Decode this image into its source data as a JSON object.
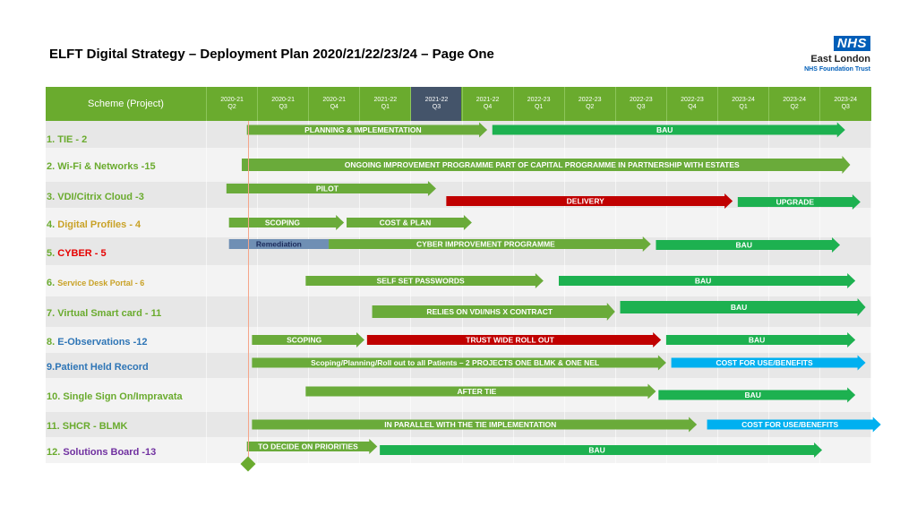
{
  "title": "ELFT Digital Strategy – Deployment Plan 2020/21/22/23/24 – Page One",
  "logo": {
    "mark": "NHS",
    "org": "East London",
    "trust": "NHS Foundation Trust"
  },
  "header": {
    "scheme_label": "Scheme (Project)",
    "quarters": [
      {
        "year": "2020-21",
        "q": "Q2"
      },
      {
        "year": "2020-21",
        "q": "Q3"
      },
      {
        "year": "2020-21",
        "q": "Q4"
      },
      {
        "year": "2021-22",
        "q": "Q1"
      },
      {
        "year": "2021-22",
        "q": "Q3"
      },
      {
        "year": "2021-22",
        "q": "Q4"
      },
      {
        "year": "2022-23",
        "q": "Q1"
      },
      {
        "year": "2022-23",
        "q": "Q2"
      },
      {
        "year": "2022-23",
        "q": "Q3"
      },
      {
        "year": "2022-23",
        "q": "Q4"
      },
      {
        "year": "2023-24",
        "q": "Q1"
      },
      {
        "year": "2023-24",
        "q": "Q2"
      },
      {
        "year": "2023-24",
        "q": "Q3"
      }
    ],
    "current_quarter_index": 4
  },
  "colors": {
    "header_green": "#6aab2e",
    "bar_light_green": "#6aab3a",
    "bar_green": "#1db150",
    "bar_red": "#c00000",
    "bar_blue": "#00b0f0",
    "bar_slate": "#6f8fb4",
    "row_alt": "#e7e7e7",
    "row_white": "#f3f3f3"
  },
  "chart_data": {
    "type": "gantt",
    "rows": [
      {
        "num": "1.",
        "name": "TIE - 2",
        "name_color": "#6aab2e",
        "bars": [
          {
            "label": "PLANNING & IMPLEMENTATION",
            "start": 0.8,
            "end": 5.5,
            "color": "bar_light_green"
          },
          {
            "label": "BAU",
            "start": 5.6,
            "end": 12.5,
            "color": "bar_green"
          }
        ]
      },
      {
        "num": "2.",
        "name": "Wi-Fi & Networks -15",
        "name_color": "#6aab2e",
        "bars": [
          {
            "label": "ONGOING IMPROVEMENT PROGRAMME PART OF CAPITAL PROGRAMME IN PARTNERSHIP WITH ESTATES",
            "start": 0.7,
            "end": 12.6,
            "color": "bar_light_green"
          }
        ]
      },
      {
        "num": "3.",
        "name": "VDI/Citrix Cloud -3",
        "name_color": "#6aab2e",
        "bars": [
          {
            "label": "PILOT",
            "start": 0.4,
            "end": 4.5,
            "color": "bar_light_green"
          },
          {
            "label": "DELIVERY",
            "start": 4.7,
            "end": 10.3,
            "color": "bar_red"
          },
          {
            "label": "UPGRADE",
            "start": 10.4,
            "end": 12.8,
            "color": "bar_green"
          }
        ]
      },
      {
        "num": "4.",
        "name": "Digital Profiles - 4",
        "name_color": "#c9a227",
        "bars": [
          {
            "label": "SCOPING",
            "start": 0.45,
            "end": 2.7,
            "color": "bar_light_green"
          },
          {
            "label": "COST & PLAN",
            "start": 2.75,
            "end": 5.2,
            "color": "bar_light_green"
          }
        ]
      },
      {
        "num": "5.",
        "name": "CYBER - 5",
        "name_color": "#e60000",
        "bars": [
          {
            "label": "Remediation",
            "start": 0.45,
            "end": 2.4,
            "color": "bar_slate",
            "dark": true
          },
          {
            "label": "CYBER IMPROVEMENT PROGRAMME",
            "start": 2.4,
            "end": 8.7,
            "color": "bar_light_green"
          },
          {
            "label": "BAU",
            "start": 8.8,
            "end": 12.4,
            "color": "bar_green"
          }
        ]
      },
      {
        "num": "6.",
        "name": "Service Desk Portal - 6",
        "name_color": "#c9a227",
        "bars": [
          {
            "label": "SELF SET PASSWORDS",
            "start": 1.95,
            "end": 6.6,
            "color": "bar_light_green"
          },
          {
            "label": "BAU",
            "start": 6.9,
            "end": 12.7,
            "color": "bar_green"
          }
        ]
      },
      {
        "num": "7.",
        "name": "Virtual Smart card - 11",
        "name_color": "#6aab2e",
        "bars": [
          {
            "label": "RELIES ON VDI/NHS X CONTRACT",
            "start": 3.25,
            "end": 8.0,
            "color": "bar_light_green"
          },
          {
            "label": "BAU",
            "start": 8.1,
            "end": 12.9,
            "color": "bar_green"
          }
        ]
      },
      {
        "num": "8.",
        "name": "E-Observations -12",
        "name_color": "#2e75b6",
        "bars": [
          {
            "label": "SCOPING",
            "start": 0.9,
            "end": 3.1,
            "color": "bar_light_green"
          },
          {
            "label": "TRUST WIDE ROLL OUT",
            "start": 3.15,
            "end": 8.9,
            "color": "bar_red"
          },
          {
            "label": "BAU",
            "start": 9.0,
            "end": 12.7,
            "color": "bar_green"
          }
        ]
      },
      {
        "num": "9.",
        "name": "Patient Held Record",
        "name_color": "#2e75b6",
        "bars": [
          {
            "label": "Scoping/Planning/Roll out to all Patients – 2 PROJECTS ONE BLMK  & ONE NEL",
            "start": 0.9,
            "end": 9.0,
            "color": "bar_light_green"
          },
          {
            "label": "COST FOR USE/BENEFITS",
            "start": 9.1,
            "end": 12.9,
            "color": "bar_blue"
          }
        ]
      },
      {
        "num": "10.",
        "name": "Single Sign On/Impravata",
        "name_color": "#6aab2e",
        "bars": [
          {
            "label": "AFTER  TIE",
            "start": 1.95,
            "end": 8.8,
            "color": "bar_light_green"
          },
          {
            "label": "BAU",
            "start": 8.85,
            "end": 12.7,
            "color": "bar_green"
          }
        ]
      },
      {
        "num": "11.",
        "name": "SHCR - BLMK",
        "name_color": "#6aab2e",
        "bars": [
          {
            "label": "IN PARALLEL WITH THE TIE IMPLEMENTATION",
            "start": 0.9,
            "end": 9.6,
            "color": "bar_light_green"
          },
          {
            "label": "COST FOR USE/BENEFITS",
            "start": 9.8,
            "end": 13.2,
            "color": "bar_blue"
          }
        ]
      },
      {
        "num": "12.",
        "name": "Solutions Board -13",
        "name_color": "#7030a0",
        "bars": [
          {
            "label": "TO DECIDE ON PRIORITIES",
            "start": 0.8,
            "end": 3.35,
            "color": "bar_light_green"
          },
          {
            "label": "BAU",
            "start": 3.4,
            "end": 12.05,
            "color": "bar_green"
          }
        ]
      }
    ]
  }
}
